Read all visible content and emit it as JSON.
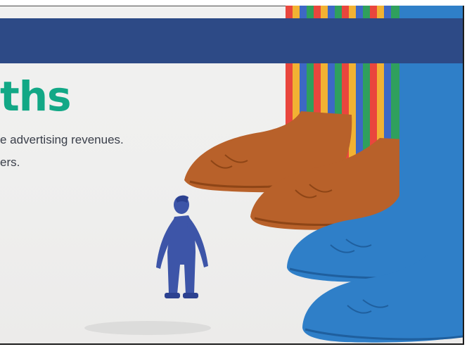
{
  "slide": {
    "title": "ths",
    "body": [
      "e advertising revenues.",
      "ers."
    ]
  },
  "colors": {
    "header_band": "#2d4a86",
    "title": "#12a886",
    "text": "#3a3f4a",
    "giant_brown_shoe": "#b8612a",
    "giant_blue_shoe": "#2f7fc8",
    "small_person": "#3d55a8"
  },
  "illustration": {
    "icons": [
      "giant-striped-legs",
      "brown-shoe-icon",
      "blue-shoe-icon",
      "small-person-icon"
    ]
  }
}
